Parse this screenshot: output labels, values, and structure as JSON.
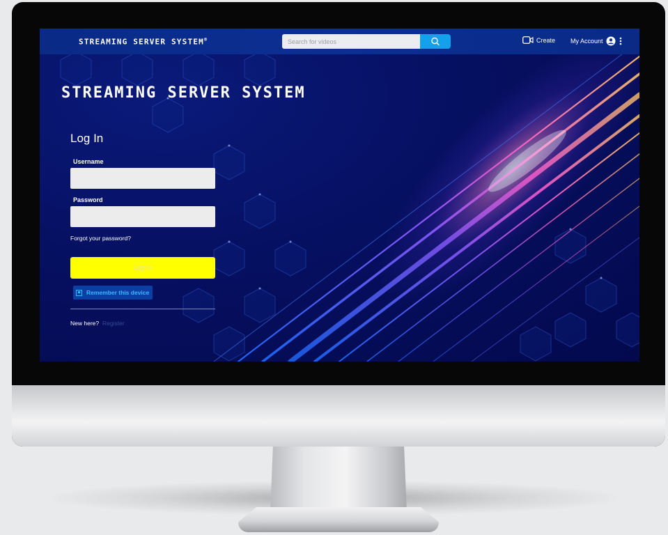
{
  "header": {
    "brand": "STREAMING SERVER SYSTEM",
    "brand_mark": "®",
    "search_placeholder": "Search for videos",
    "create_label": "Create",
    "account_label": "My Account"
  },
  "hero": {
    "title": "STREAMING SERVER SYSTEM"
  },
  "login": {
    "title": "Log In",
    "username_label": "Username",
    "username_value": "",
    "password_label": "Password",
    "password_value": "",
    "forgot_label": "Forgot your password?",
    "submit_label": "Log In",
    "remember_label": "Remember this device",
    "remember_checked": true,
    "new_here_label": "New here?",
    "register_label": "Register"
  },
  "colors": {
    "login_button": "#ffff00",
    "search_button": "#15a0ec",
    "remember_accent": "#39b8ff"
  },
  "icons": [
    "search-icon",
    "video-camera-icon",
    "account-circle-icon",
    "more-vertical-icon",
    "checkbox-icon"
  ]
}
